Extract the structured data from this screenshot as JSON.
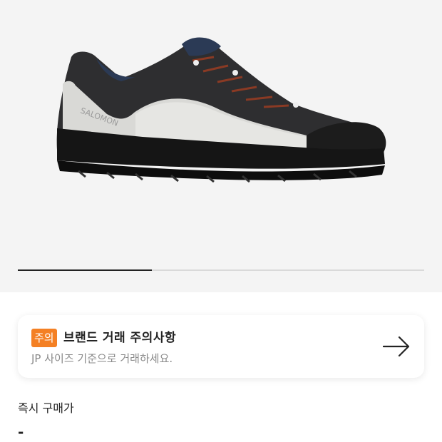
{
  "product": {
    "image_icon": "shoe-image",
    "image_progress": 0.33
  },
  "notice": {
    "badge": "주의",
    "title": "브랜드 거래 주의사항",
    "subtitle": "JP 사이즈 기준으로 거래하세요.",
    "arrow_icon": "arrow-right-icon",
    "badge_color": "#f48024"
  },
  "price": {
    "label": "즉시 구매가",
    "value": "-"
  }
}
